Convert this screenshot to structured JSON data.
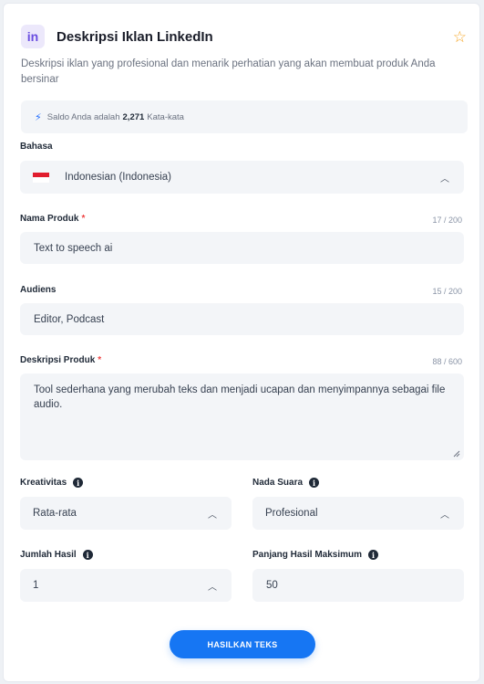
{
  "header": {
    "logo_text": "in",
    "title": "Deskripsi Iklan LinkedIn",
    "star_icon": "star-icon"
  },
  "description": "Deskripsi iklan yang profesional dan menarik perhatian yang akan membuat produk Anda bersinar",
  "saldo": {
    "prefix": "Saldo Anda adalah",
    "count": "2,271",
    "suffix": "Kata-kata"
  },
  "bahasa": {
    "label": "Bahasa",
    "value": "Indonesian (Indonesia)"
  },
  "nama_produk": {
    "label": "Nama Produk",
    "counter": "17 / 200",
    "value": "Text to speech ai"
  },
  "audiens": {
    "label": "Audiens",
    "counter": "15 / 200",
    "value": "Editor, Podcast"
  },
  "deskripsi_produk": {
    "label": "Deskripsi Produk",
    "counter": "88 / 600",
    "value": "Tool sederhana yang merubah teks dan menjadi ucapan dan menyimpannya sebagai file audio."
  },
  "kreativitas": {
    "label": "Kreativitas",
    "value": "Rata-rata"
  },
  "nada_suara": {
    "label": "Nada Suara",
    "value": "Profesional"
  },
  "jumlah_hasil": {
    "label": "Jumlah Hasil",
    "value": "1"
  },
  "panjang_hasil": {
    "label": "Panjang Hasil Maksimum",
    "value": "50"
  },
  "submit": {
    "label": "HASILKAN TEKS"
  },
  "colors": {
    "accent": "#1676f3",
    "logo_bg": "#ece8fb",
    "logo_fg": "#6a4ee0",
    "star": "#f5a524",
    "required": "#ef4444"
  }
}
